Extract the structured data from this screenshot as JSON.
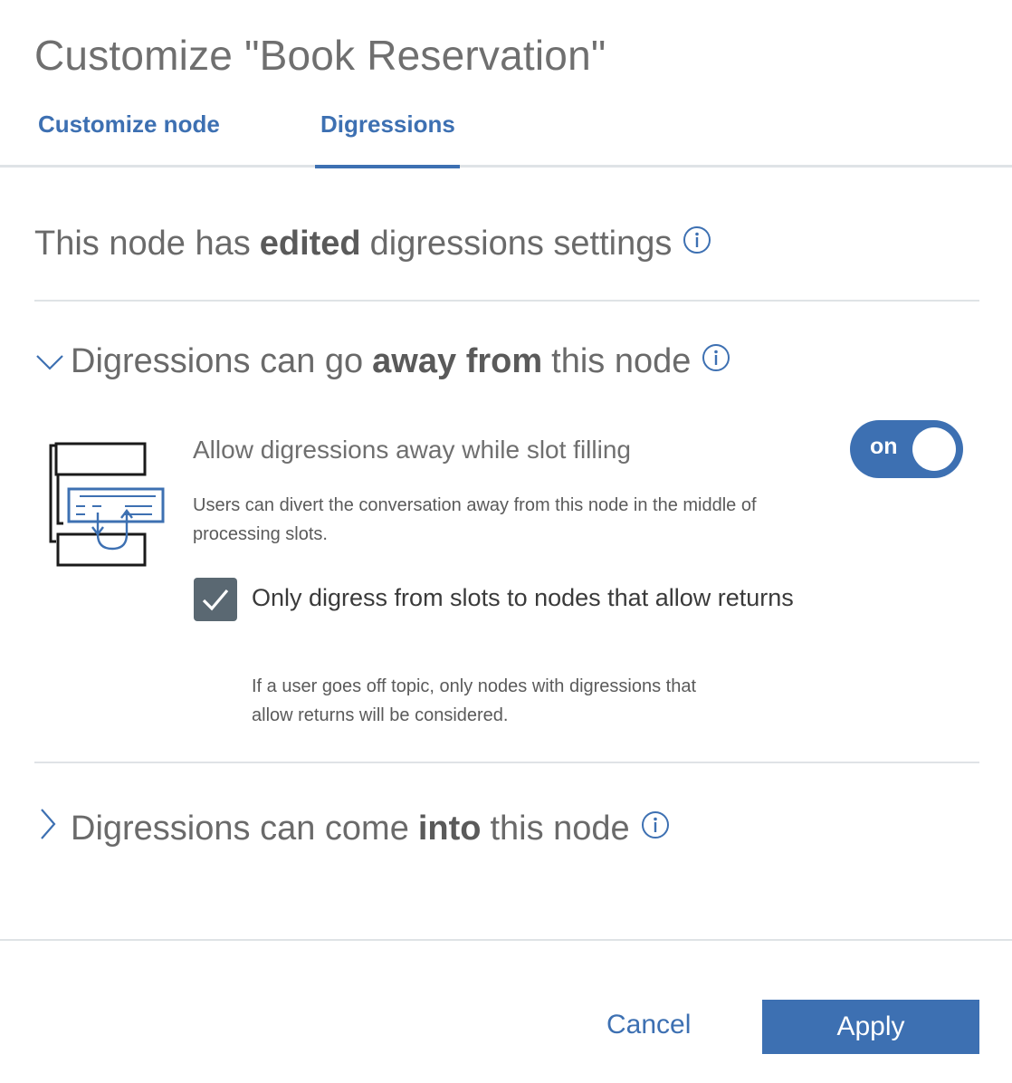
{
  "dialog": {
    "title": "Customize \"Book Reservation\""
  },
  "tabs": [
    {
      "label": "Customize node",
      "active": false
    },
    {
      "label": "Digressions",
      "active": true
    }
  ],
  "status": {
    "prefix": "This node has",
    "emphasis": "edited",
    "suffix": "digressions settings",
    "icon": "info-icon"
  },
  "away_section": {
    "expanded": true,
    "prefix": "Digressions can go",
    "emphasis": "away from",
    "suffix": "this node",
    "icon": "info-icon",
    "slot_filling": {
      "title": "Allow digressions away while slot filling",
      "description": "Users can divert the conversation away from this node in the middle of processing slots.",
      "toggle_label": "on",
      "toggle_on": true
    },
    "returns_checkbox": {
      "checked": true,
      "label": "Only digress from slots to nodes that allow returns",
      "description": "If a user goes off topic, only nodes with digressions that allow returns will be considered."
    }
  },
  "into_section": {
    "expanded": false,
    "prefix": "Digressions can come",
    "emphasis": "into",
    "suffix": "this node",
    "icon": "info-icon"
  },
  "footer": {
    "cancel_label": "Cancel",
    "apply_label": "Apply"
  },
  "colors": {
    "accent": "#3d70b2",
    "checkbox": "#5a6872",
    "divider": "#dfe3e6"
  }
}
